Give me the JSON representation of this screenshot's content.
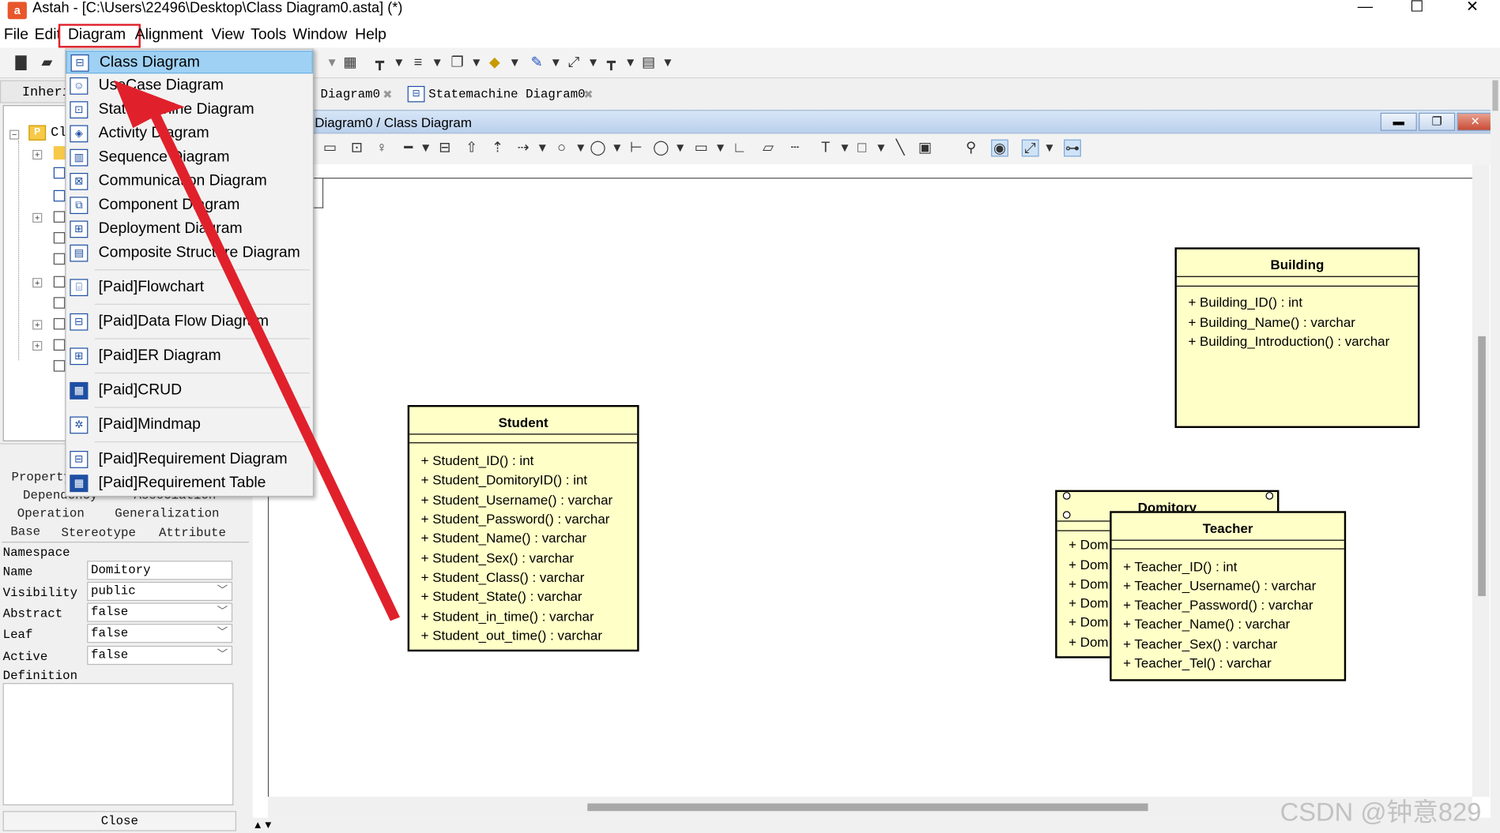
{
  "window": {
    "app_logo": "a",
    "title": "Astah - [C:\\Users\\22496\\Desktop\\Class Diagram0.asta] (*)",
    "minimize": "—",
    "maximize": "☐",
    "close": "✕"
  },
  "menubar": {
    "items": [
      "File",
      "Edit",
      "Diagram",
      "Alignment",
      "View",
      "Tools",
      "Window",
      "Help"
    ]
  },
  "left_panel": {
    "tab_label": "Inheri",
    "tree_root_label": "Cl",
    "property_tabs_row1": [
      "Property",
      "Dependency",
      "Association"
    ],
    "property_tabs_row2": [
      "Operation",
      "Generalization"
    ],
    "property_tabs_row3": [
      "Base",
      "Stereotype",
      "Attribute"
    ],
    "namespace_label": "Namespace",
    "fields": [
      {
        "label": "Name",
        "value": "Domitory",
        "dropdown": false
      },
      {
        "label": "Visibility",
        "value": "public",
        "dropdown": true
      },
      {
        "label": "Abstract",
        "value": "false",
        "dropdown": true
      },
      {
        "label": "Leaf",
        "value": "false",
        "dropdown": true
      },
      {
        "label": "Active",
        "value": "false",
        "dropdown": true
      }
    ],
    "definition_label": "Definition",
    "close_button": "Close"
  },
  "diagram_tabs": [
    "Diagram0",
    "Statemachine Diagram0"
  ],
  "diagram_window": {
    "title": "Diagram0 / Class Diagram"
  },
  "diagram_menu": {
    "items": [
      {
        "label": "Class Diagram",
        "selected": true
      },
      {
        "label": "UseCase Diagram"
      },
      {
        "label": "Statemachine Diagram"
      },
      {
        "label": "Activity Diagram"
      },
      {
        "label": "Sequence Diagram"
      },
      {
        "label": "Communication Diagram"
      },
      {
        "label": "Component Diagram"
      },
      {
        "label": "Deployment Diagram"
      },
      {
        "label": "Composite Structure Diagram"
      },
      {
        "label": "[Paid]Flowchart"
      },
      {
        "label": "[Paid]Data Flow Diagram"
      },
      {
        "label": "[Paid]ER Diagram"
      },
      {
        "label": "[Paid]CRUD"
      },
      {
        "label": "[Paid]Mindmap"
      },
      {
        "label": "[Paid]Requirement Diagram"
      },
      {
        "label": "[Paid]Requirement Table"
      }
    ]
  },
  "classes": {
    "student": {
      "name": "Student",
      "attributes": [
        "+ Student_ID() : int",
        "+ Student_DomitoryID() : int",
        "+ Student_Username() : varchar",
        "+ Student_Password() : varchar",
        "+ Student_Name() : varchar",
        "+ Student_Sex() : varchar",
        "+ Student_Class() : varchar",
        "+ Student_State() : varchar",
        "+ Student_in_time() : varchar",
        "+ Student_out_time() : varchar"
      ]
    },
    "building": {
      "name": "Building",
      "attributes": [
        "+ Building_ID() : int",
        "+ Building_Name() : varchar",
        "+ Building_Introduction() : varchar"
      ]
    },
    "domitory": {
      "name": "Domitory",
      "attributes": [
        "+ Dom",
        "+ Dom",
        "+ Dom",
        "+ Dom",
        "+ Dom",
        "+ Dom"
      ]
    },
    "teacher": {
      "name": "Teacher",
      "attributes": [
        "+ Teacher_ID() : int",
        "+ Teacher_Username() : varchar",
        "+ Teacher_Password() : varchar",
        "+ Teacher_Name() : varchar",
        "+ Teacher_Sex() : varchar",
        "+ Teacher_Tel() : varchar"
      ]
    }
  },
  "watermark": "CSDN @钟意829",
  "colors": {
    "class_fill": "#ffffc8",
    "menu_highlight": "#9fd1f4",
    "annotation_red": "#e0212b"
  }
}
